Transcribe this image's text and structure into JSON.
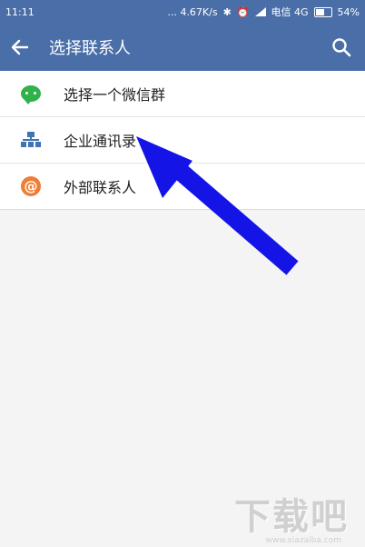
{
  "status_bar": {
    "time": "11:11",
    "speed": "... 4.67K/s",
    "carrier": "电信 4G",
    "battery": "54%"
  },
  "app_bar": {
    "title": "选择联系人",
    "back_icon": "arrow-left-icon",
    "search_icon": "search-icon"
  },
  "list": {
    "items": [
      {
        "label": "选择一个微信群",
        "icon": "wechat-group-icon",
        "icon_color": "#30b24a"
      },
      {
        "label": "企业通讯录",
        "icon": "org-chart-icon",
        "icon_color": "#3e73b4"
      },
      {
        "label": "外部联系人",
        "icon": "at-icon",
        "icon_color": "#f07d34",
        "icon_text": "@"
      }
    ]
  },
  "annotation": {
    "arrow_color": "#1414e6"
  },
  "watermark": {
    "text": "下载吧",
    "url": "www.xiazaiba.com"
  }
}
